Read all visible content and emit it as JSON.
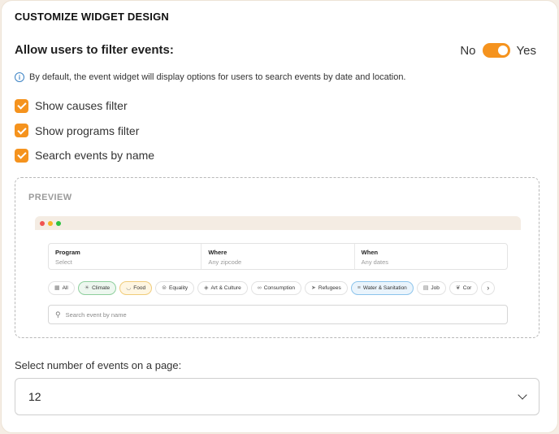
{
  "section_title": "CUSTOMIZE WIDGET DESIGN",
  "filter_toggle": {
    "label": "Allow users to filter events:",
    "off_label": "No",
    "on_label": "Yes",
    "enabled": true
  },
  "info_text": "By default, the event widget will display options for users to search events by date and location.",
  "checkboxes": [
    {
      "label": "Show causes filter",
      "checked": true
    },
    {
      "label": "Show programs filter",
      "checked": true
    },
    {
      "label": "Search events by name",
      "checked": true
    }
  ],
  "preview": {
    "title": "PREVIEW",
    "fields": [
      {
        "label": "Program",
        "placeholder": "Select"
      },
      {
        "label": "Where",
        "placeholder": "Any zipcode"
      },
      {
        "label": "When",
        "placeholder": "Any dates"
      }
    ],
    "chips": [
      {
        "label": "All",
        "icon": "grid-icon",
        "style": "plain"
      },
      {
        "label": "Climate",
        "icon": "sun-icon",
        "style": "green"
      },
      {
        "label": "Food",
        "icon": "bowl-icon",
        "style": "yellow"
      },
      {
        "label": "Equality",
        "icon": "equality-icon",
        "style": "plain"
      },
      {
        "label": "Art & Culture",
        "icon": "palette-icon",
        "style": "plain"
      },
      {
        "label": "Consumption",
        "icon": "infinity-icon",
        "style": "plain"
      },
      {
        "label": "Refugees",
        "icon": "plane-icon",
        "style": "plain"
      },
      {
        "label": "Water & Sanitation",
        "icon": "water-icon",
        "style": "blue"
      },
      {
        "label": "Job",
        "icon": "briefcase-icon",
        "style": "plain"
      },
      {
        "label": "Cor",
        "icon": "leaf-icon",
        "style": "plain"
      }
    ],
    "name_search_placeholder": "Search event by name"
  },
  "events_per_page": {
    "label": "Select number of events on a page:",
    "value": "12"
  },
  "colors": {
    "accent": "#f5931e",
    "info": "#3b82c4"
  }
}
